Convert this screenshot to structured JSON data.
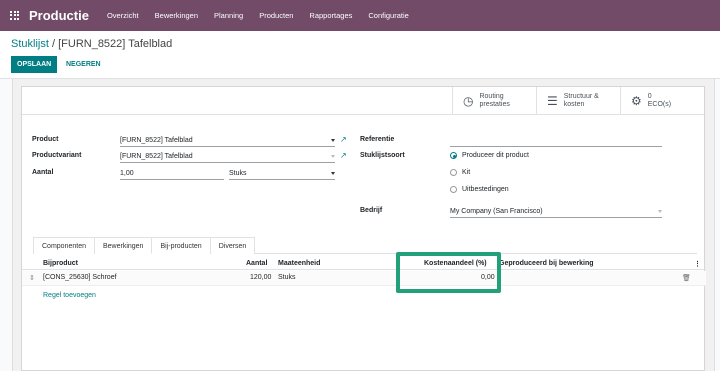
{
  "app": {
    "name": "Productie",
    "menu": [
      "Overzicht",
      "Bewerkingen",
      "Planning",
      "Producten",
      "Rapportages",
      "Configuratie"
    ]
  },
  "breadcrumb": {
    "parent": "Stuklijst",
    "separator": "/",
    "current": "[FURN_8522] Tafelblad"
  },
  "actions": {
    "save": "OPSLAAN",
    "discard": "NEGEREN"
  },
  "smart_buttons": [
    {
      "icon": "clock-icon",
      "line1": "Routing",
      "line2": "prestaties"
    },
    {
      "icon": "list-icon",
      "line1": "Structuur &",
      "line2": "kosten"
    },
    {
      "icon": "gears-icon",
      "line1": "0",
      "line2": "ECO(s)"
    }
  ],
  "form": {
    "product_label": "Product",
    "product_value": "[FURN_8522] Tafelblad",
    "variant_label": "Productvariant",
    "variant_value": "[FURN_8522] Tafelblad",
    "qty_label": "Aantal",
    "qty_value": "1,00",
    "uom_value": "Stuks",
    "reference_label": "Referentie",
    "reference_value": "",
    "type_label": "Stuklijstsoort",
    "type_options": [
      "Produceer dit product",
      "Kit",
      "Uitbestedingen"
    ],
    "type_selected": 0,
    "company_label": "Bedrijf",
    "company_value": "My Company (San Francisco)"
  },
  "tabs": [
    "Componenten",
    "Bewerkingen",
    "Bij-producten",
    "Diversen"
  ],
  "active_tab": 2,
  "table": {
    "headers": {
      "byproduct": "Bijproduct",
      "qty": "Aantal",
      "uom": "Maateenheid",
      "cost_share": "Kostenaandeel (%)",
      "produced_in": "Geproduceerd bij bewerking"
    },
    "rows": [
      {
        "byproduct": "[CONS_25630] Schroef",
        "qty": "120,00",
        "uom": "Stuks",
        "cost_share": "0,00",
        "produced_in": ""
      }
    ],
    "add_line": "Regel toevoegen"
  }
}
